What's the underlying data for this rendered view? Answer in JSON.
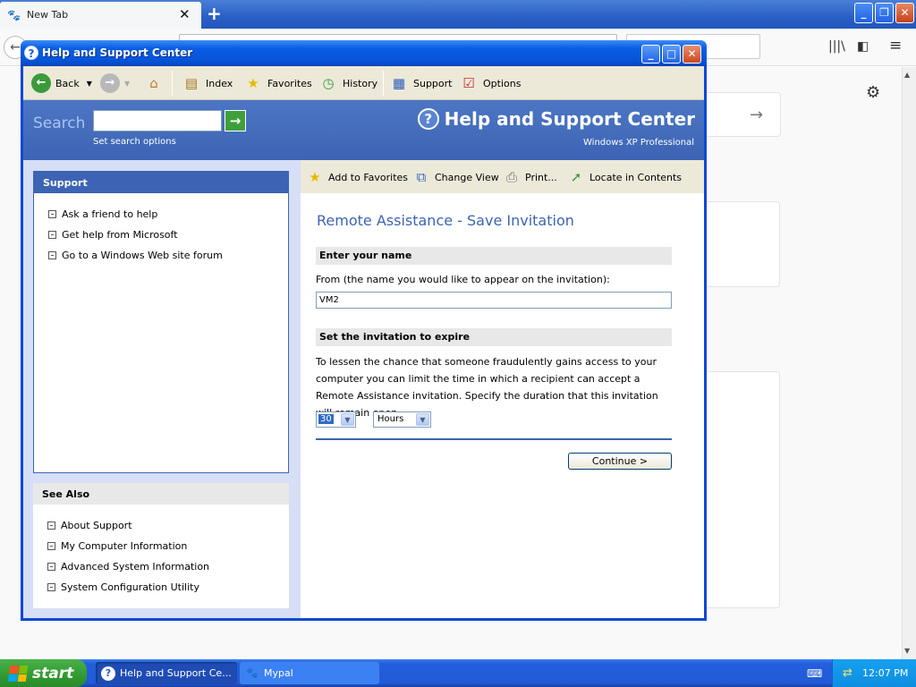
{
  "firefox": {
    "tab_title": "New Tab",
    "tab_close": "✕",
    "new_tab": "+",
    "back": "←",
    "library_icon": "|||\\",
    "sidebar_icon": "◧",
    "menu_icon": "≡",
    "gear_icon": "⚙",
    "search_arrow": "→",
    "win_min": "_",
    "win_max": "❐",
    "win_close": "✕"
  },
  "help_window": {
    "title": "Help and Support Center",
    "toolbar": {
      "back": "Back",
      "index": "Index",
      "favorites": "Favorites",
      "history": "History",
      "support": "Support",
      "options": "Options"
    },
    "banner": {
      "search_label": "Search",
      "search_value": "",
      "search_options": "Set search options",
      "title": "Help and Support Center",
      "subtitle": "Windows XP Professional"
    },
    "left": {
      "support_header": "Support",
      "support_links": [
        "Ask a friend to help",
        "Get help from Microsoft",
        "Go to a Windows Web site forum"
      ],
      "see_also_header": "See Also",
      "see_also_links": [
        "About Support",
        "My Computer Information",
        "Advanced System Information",
        "System Configuration Utility"
      ]
    },
    "right_toolbar": {
      "add_favorites": "Add to Favorites",
      "change_view": "Change View",
      "print": "Print...",
      "locate": "Locate in Contents"
    },
    "content": {
      "title": "Remote Assistance - Save Invitation",
      "section1": "Enter your name",
      "from_label": "From (the name you would like to appear on the invitation):",
      "name_value": "VM2",
      "section2": "Set the invitation to expire",
      "expire_text": "To lessen the chance that someone fraudulently gains access to your computer you can limit the time in which a recipient can accept a Remote Assistance invitation. Specify the duration that this invitation will remain open.",
      "duration_value": "30",
      "unit_value": "Hours",
      "continue_button": "Continue >"
    }
  },
  "taskbar": {
    "start": "start",
    "tasks": [
      "Help and Support Ce...",
      "Mypal"
    ],
    "clock": "12:07 PM"
  }
}
